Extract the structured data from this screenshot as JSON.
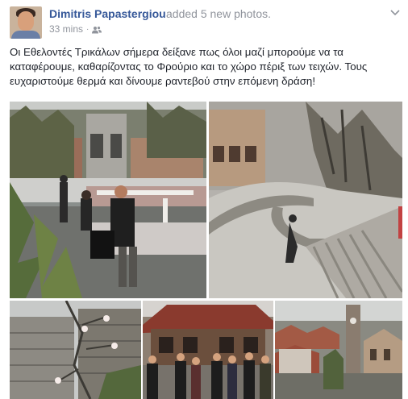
{
  "post": {
    "author": "Dimitris Papastergiou",
    "action": "added 5 new photos.",
    "timestamp": "33 mins",
    "separator": "·",
    "audience_icon": "friends-icon",
    "menu_icon": "chevron-down-icon",
    "text": "Οι Εθελοντές Τρικάλων σήμερα δείξανε πως όλοι μαζί μπορούμε να τα καταφέρουμε, καθαρίζοντας το Φρούριο και το χώρο πέριξ των τειχών. Τους ευχαριστούμε θερμά και δίνουμε ραντεβού στην επόμενη δράση!",
    "photo_count": 5
  },
  "colors": {
    "author_link": "#365899",
    "secondary_text": "#90949c",
    "body_text": "#1d2129",
    "background": "#ffffff"
  }
}
